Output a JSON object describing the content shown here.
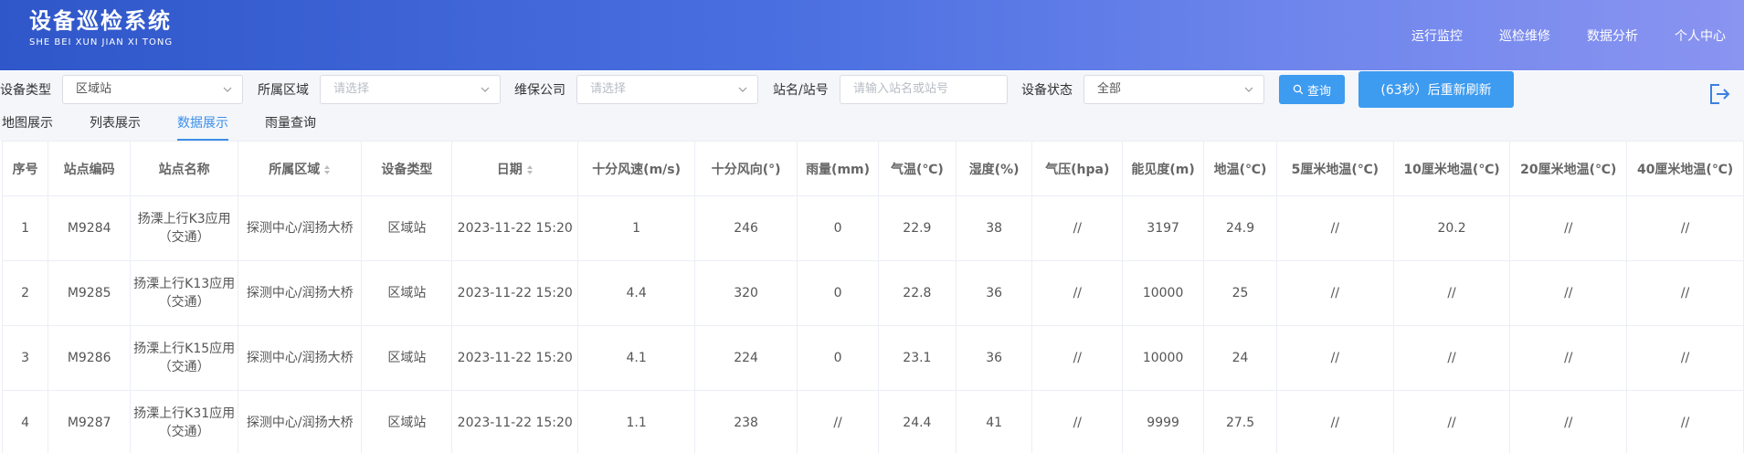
{
  "header": {
    "title": "设备巡检系统",
    "subtitle": "SHE BEI XUN JIAN XI TONG",
    "nav": [
      "运行监控",
      "巡检维修",
      "数据分析",
      "个人中心"
    ]
  },
  "filters": {
    "device_type_label": "设备类型",
    "device_type_value": "区域站",
    "region_label": "所属区域",
    "region_placeholder": "请选择",
    "company_label": "维保公司",
    "company_placeholder": "请选择",
    "station_label": "站名/站号",
    "station_placeholder": "请输入站名或站号",
    "status_label": "设备状态",
    "status_value": "全部",
    "query_label": "查询",
    "refresh_label": "(63秒）后重新刷新"
  },
  "tabs": [
    "地图展示",
    "列表展示",
    "数据展示",
    "雨量查询"
  ],
  "active_tab": "数据展示",
  "table": {
    "columns": [
      "序号",
      "站点编码",
      "站点名称",
      "所属区域",
      "设备类型",
      "日期",
      "十分风速(m/s)",
      "十分风向(°)",
      "雨量(mm)",
      "气温(℃)",
      "湿度(%)",
      "气压(hpa)",
      "能见度(m)",
      "地温(℃)",
      "5厘米地温(℃)",
      "10厘米地温(℃)",
      "20厘米地温(℃)",
      "40厘米地温(℃)"
    ],
    "rows": [
      [
        "1",
        "M9284",
        "扬溧上行K3应用（交通）",
        "探测中心/润扬大桥",
        "区域站",
        "2023-11-22 15:20",
        "1",
        "246",
        "0",
        "22.9",
        "38",
        "//",
        "3197",
        "24.9",
        "//",
        "20.2",
        "//",
        "//"
      ],
      [
        "2",
        "M9285",
        "扬溧上行K13应用（交通）",
        "探测中心/润扬大桥",
        "区域站",
        "2023-11-22 15:20",
        "4.4",
        "320",
        "0",
        "22.8",
        "36",
        "//",
        "10000",
        "25",
        "//",
        "//",
        "//",
        "//"
      ],
      [
        "3",
        "M9286",
        "扬溧上行K15应用（交通）",
        "探测中心/润扬大桥",
        "区域站",
        "2023-11-22 15:20",
        "4.1",
        "224",
        "0",
        "23.1",
        "36",
        "//",
        "10000",
        "24",
        "//",
        "//",
        "//",
        "//"
      ],
      [
        "4",
        "M9287",
        "扬溧上行K31应用（交通）",
        "探测中心/润扬大桥",
        "区域站",
        "2023-11-22 15:20",
        "1.1",
        "238",
        "//",
        "24.4",
        "41",
        "//",
        "9999",
        "27.5",
        "//",
        "//",
        "//",
        "//"
      ]
    ]
  },
  "colors": {
    "accent": "#3d9bf0",
    "header_start": "#2f57c9",
    "header_end": "#8a94f1",
    "active_tab": "#3d8ee8"
  }
}
